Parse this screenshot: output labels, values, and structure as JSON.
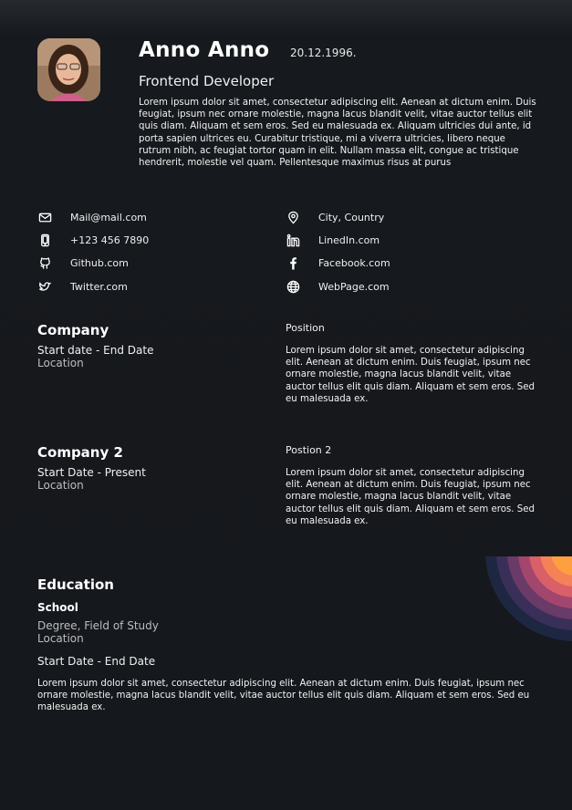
{
  "header": {
    "name": "Anno Anno",
    "dob": "20.12.1996.",
    "role": "Frontend Developer",
    "summary": "Lorem ipsum dolor sit amet, consectetur adipiscing elit. Aenean at dictum enim. Duis feugiat, ipsum nec ornare molestie, magna lacus blandit velit, vitae auctor tellus elit quis diam. Aliquam et sem eros. Sed eu malesuada ex. Aliquam ultricies dui ante, id porta sapien ultrices eu. Curabitur tristique, mi a viverra ultricies, libero neque rutrum nibh, ac feugiat tortor quam in elit. Nullam massa elit, congue ac tristique hendrerit, molestie vel quam. Pellentesque maximus risus at purus"
  },
  "contacts": {
    "mail": "Mail@mail.com",
    "phone": "+123 456 7890",
    "github": "Github.com",
    "twitter": "Twitter.com",
    "location": "City, Country",
    "linkedin": "LinedIn.com",
    "facebook": "Facebook.com",
    "webpage": "WebPage.com"
  },
  "icons": [
    "mail-icon",
    "phone-icon",
    "github-icon",
    "twitter-icon",
    "location-icon",
    "linkedin-icon",
    "facebook-icon",
    "globe-icon"
  ],
  "experience": [
    {
      "company": "Company",
      "dates": "Start date - End  Date",
      "location": "Location",
      "position": "Position",
      "description": "Lorem ipsum dolor sit amet, consectetur adipiscing elit. Aenean at dictum enim. Duis feugiat, ipsum nec ornare molestie, magna lacus blandit velit, vitae auctor tellus elit quis diam. Aliquam et sem eros. Sed eu malesuada ex."
    },
    {
      "company": "Company 2",
      "dates": "Start Date - Present",
      "location": "Location",
      "position": "Postion 2",
      "description": "Lorem ipsum dolor sit amet, consectetur adipiscing elit. Aenean at dictum enim. Duis feugiat, ipsum nec ornare molestie, magna lacus blandit velit, vitae auctor tellus elit quis diam. Aliquam et sem eros. Sed eu malesuada ex."
    }
  ],
  "education": {
    "title": "Education",
    "school": "School",
    "degree": "Degree, Field of Study",
    "location": "Location",
    "dates": "Start Date - End Date",
    "description": "Lorem ipsum dolor sit amet, consectetur adipiscing elit. Aenean at dictum enim. Duis feugiat, ipsum nec ornare molestie, magna lacus blandit velit, vitae auctor tellus elit quis diam. Aliquam et sem eros. Sed eu malesuada ex."
  },
  "colors": {
    "background": "#15181c",
    "text": "#ffffff",
    "muted": "#bdbdbd",
    "deco_outer": "#1f2a44",
    "deco_inner": "#ffa040"
  }
}
